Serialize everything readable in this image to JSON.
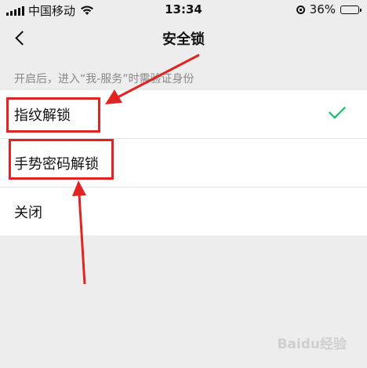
{
  "status_bar": {
    "carrier": "中国移动",
    "time": "13:34",
    "battery": "36%",
    "battery_level": 0.36
  },
  "nav": {
    "title": "安全锁"
  },
  "hint": "开启后，进入“我-服务”时需验证身份",
  "options": [
    {
      "label": "指纹解锁",
      "selected": true
    },
    {
      "label": "手势密码解锁",
      "selected": false
    },
    {
      "label": "关闭",
      "selected": false
    }
  ],
  "colors": {
    "accent": "#07c160",
    "annotation": "#e02424"
  },
  "icons": {
    "back": "chevron-left-icon",
    "check": "check-icon"
  },
  "watermark": "Baidu经验"
}
